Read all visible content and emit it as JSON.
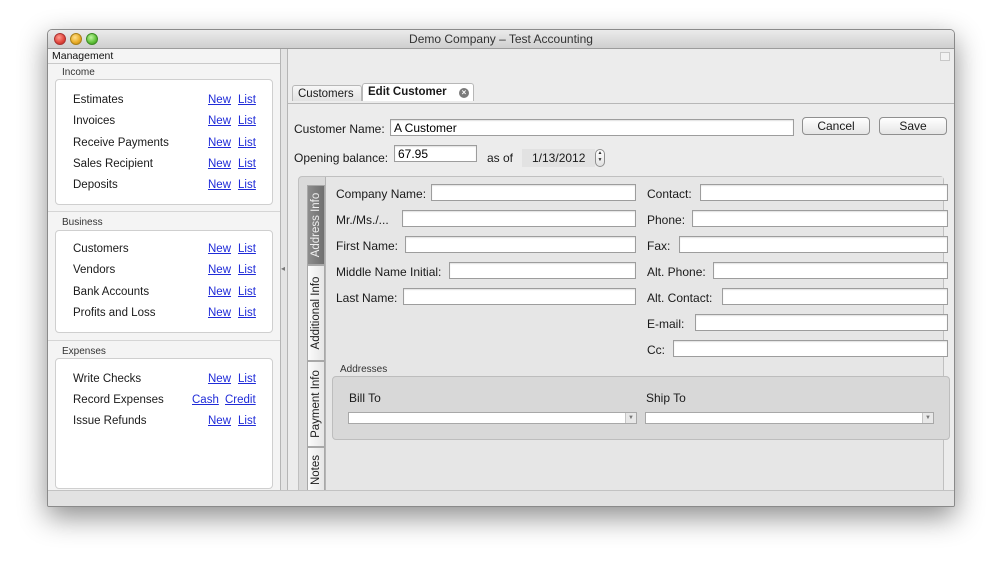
{
  "window": {
    "title": "Demo Company – Test Accounting"
  },
  "sidebar": {
    "header": "Management",
    "groups": [
      {
        "title": "Income",
        "items": [
          {
            "label": "Estimates",
            "link1": "New",
            "link2": "List"
          },
          {
            "label": "Invoices",
            "link1": "New",
            "link2": "List"
          },
          {
            "label": "Receive Payments",
            "link1": "New",
            "link2": "List"
          },
          {
            "label": "Sales Recipient",
            "link1": "New",
            "link2": "List"
          },
          {
            "label": "Deposits",
            "link1": "New",
            "link2": "List"
          }
        ]
      },
      {
        "title": "Business",
        "items": [
          {
            "label": "Customers",
            "link1": "New",
            "link2": "List"
          },
          {
            "label": "Vendors",
            "link1": "New",
            "link2": "List"
          },
          {
            "label": "Bank Accounts",
            "link1": "New",
            "link2": "List"
          },
          {
            "label": "Profits and Loss",
            "link1": "New",
            "link2": "List"
          }
        ]
      },
      {
        "title": "Expenses",
        "items": [
          {
            "label": "Write Checks",
            "link1": "New",
            "link2": "List"
          },
          {
            "label": "Record Expenses",
            "link1": "Cash",
            "link2": "Credit"
          },
          {
            "label": "Issue Refunds",
            "link1": "New",
            "link2": "List"
          }
        ]
      }
    ]
  },
  "tabs": [
    {
      "label": "Customers",
      "active": false
    },
    {
      "label": "Edit Customer",
      "active": true
    }
  ],
  "form": {
    "customer_name_label": "Customer Name:",
    "customer_name_value": "A Customer",
    "cancel_label": "Cancel",
    "save_label": "Save",
    "opening_balance_label": "Opening balance:",
    "opening_balance_value": "67.95",
    "as_of_label": "as of",
    "as_of_date": "1/13/2012"
  },
  "side_tabs": [
    {
      "label": "Address Info",
      "active": true
    },
    {
      "label": "Additional Info",
      "active": false
    },
    {
      "label": "Payment Info",
      "active": false
    },
    {
      "label": "Notes",
      "active": false
    }
  ],
  "address_info": {
    "left_fields": [
      {
        "label": "Company Name:",
        "value": ""
      },
      {
        "label": "Mr./Ms./...",
        "value": ""
      },
      {
        "label": "First Name:",
        "value": ""
      },
      {
        "label": "Middle Name Initial:",
        "value": ""
      },
      {
        "label": "Last Name:",
        "value": ""
      }
    ],
    "right_fields": [
      {
        "label": "Contact:",
        "value": ""
      },
      {
        "label": "Phone:",
        "value": ""
      },
      {
        "label": "Fax:",
        "value": ""
      },
      {
        "label": "Alt. Phone:",
        "value": ""
      },
      {
        "label": "Alt. Contact:",
        "value": ""
      },
      {
        "label": "E-mail:",
        "value": ""
      },
      {
        "label": "Cc:",
        "value": ""
      }
    ],
    "addresses_title": "Addresses",
    "bill_to_label": "Bill To",
    "ship_to_label": "Ship To",
    "bill_to_value": "",
    "ship_to_value": ""
  },
  "colors": {
    "link": "#1f2bd8",
    "active_tab": "#7a7a7a"
  }
}
